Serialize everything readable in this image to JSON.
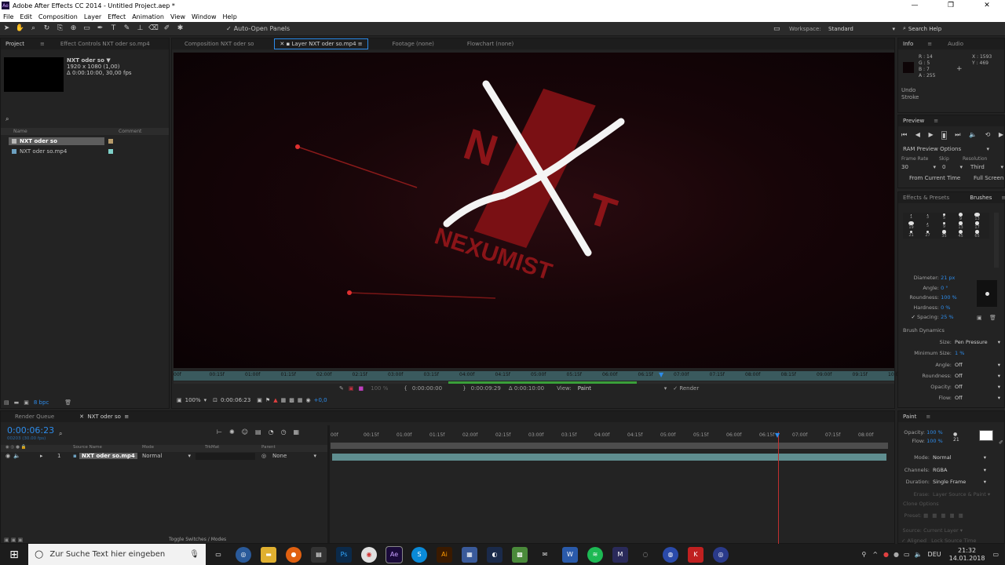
{
  "window": {
    "title": "Adobe After Effects CC 2014 - Untitled Project.aep *",
    "icon_label": "Ae"
  },
  "menu": [
    "File",
    "Edit",
    "Composition",
    "Layer",
    "Effect",
    "Animation",
    "View",
    "Window",
    "Help"
  ],
  "toolbar": {
    "auto_open": "Auto-Open Panels",
    "workspace_label": "Workspace:",
    "workspace_value": "Standard",
    "search": "Search Help"
  },
  "project": {
    "tab_project": "Project",
    "tab_effect": "Effect Controls NXT oder so.mp4",
    "item_name": "NXT oder so ▼",
    "item_res": "1920 x 1080 (1,00)",
    "item_dur": "Δ 0:00:10:00, 30,00 fps",
    "search_icon": "⌕",
    "col_name": "Name",
    "col_comment": "Comment",
    "items": [
      {
        "name": "NXT oder so",
        "color": "#b59a6a"
      },
      {
        "name": "NXT oder so.mp4",
        "color": "#7fd0c8"
      }
    ],
    "bpc": "8 bpc"
  },
  "viewer": {
    "tabs": [
      "Composition NXT oder so",
      "Layer  NXT oder so.mp4",
      "Footage (none)",
      "Flowchart (none)"
    ],
    "logo_text": "NEXUMIST",
    "ruler": [
      "00f",
      "00:15f",
      "01:00f",
      "01:15f",
      "02:00f",
      "02:15f",
      "03:00f",
      "03:15f",
      "04:00f",
      "04:15f",
      "05:00f",
      "05:15f",
      "06:00f",
      "06:15f",
      "07:00f",
      "07:15f",
      "08:00f",
      "08:15f",
      "09:00f",
      "09:15f",
      "10:0"
    ],
    "zoom_pct": "100 %",
    "t_in": "0:00:00:00",
    "t_out": "0:00:09:29",
    "t_dur": "Δ 0:00:10:00",
    "view_label": "View:",
    "view_value": "Paint",
    "render": "Render",
    "mag": "100%",
    "timecode": "0:00:06:23",
    "offset": "+0,0"
  },
  "info": {
    "tab_info": "Info",
    "tab_audio": "Audio",
    "r": "R : 14",
    "g": "G : 5",
    "b": "B : 7",
    "a": "A : 255",
    "x": "X : 1593",
    "y": "Y : 469",
    "undo": "Undo",
    "stroke": "Stroke"
  },
  "preview": {
    "tab": "Preview",
    "ram": "RAM Preview Options",
    "frame_rate_l": "Frame Rate",
    "skip_l": "Skip",
    "res_l": "Resolution",
    "frame_rate": "30",
    "skip": "0",
    "res": "Third",
    "from_current": "From Current Time",
    "full_screen": "Full Screen"
  },
  "brushes": {
    "tab_effects": "Effects & Presets",
    "tab_brushes": "Brushes",
    "sizes": [
      "1",
      "3",
      "5",
      "9",
      "13",
      "19",
      "5",
      "9",
      "13",
      "17",
      "21",
      "27",
      "35",
      "45",
      "65"
    ],
    "diameter_l": "Diameter:",
    "diameter": "21 px",
    "angle_l": "Angle:",
    "angle": "0 °",
    "roundness_l": "Roundness:",
    "roundness": "100 %",
    "hardness_l": "Hardness:",
    "hardness": "0 %",
    "spacing_l": "Spacing:",
    "spacing": "25 %",
    "dynamics": "Brush Dynamics",
    "size_l": "Size:",
    "size": "Pen Pressure",
    "minsize_l": "Minimum Size:",
    "minsize": "1 %",
    "angle2_l": "Angle:",
    "angle2": "Off",
    "roundness2_l": "Roundness:",
    "roundness2": "Off",
    "opacity_l": "Opacity:",
    "opacity": "Off",
    "flow_l": "Flow:",
    "flow": "Off"
  },
  "paint": {
    "tab": "Paint",
    "opacity_l": "Opacity:",
    "opacity": "100 %",
    "flow_l": "Flow:",
    "flow": "100 %",
    "brush_size": "21",
    "mode_l": "Mode:",
    "mode": "Normal",
    "channels_l": "Channels:",
    "channels": "RGBA",
    "duration_l": "Duration:",
    "duration": "Single Frame",
    "erase_l": "Erase:",
    "erase": "Layer Source & Paint",
    "clone": "Clone Options",
    "preset_l": "Preset:",
    "source_l": "Source:",
    "source": "Current Layer",
    "aligned": "Aligned",
    "lock": "Lock Source Time"
  },
  "timeline": {
    "tab_render": "Render Queue",
    "tab_comp": "NXT oder so",
    "timecode": "0:00:06:23",
    "frames": "00203 (30.00 fps)",
    "col_source": "Source Name",
    "col_mode": "Mode",
    "col_trkmat": "TrkMat",
    "col_parent": "Parent",
    "ruler": [
      "00f",
      "00:15f",
      "01:00f",
      "01:15f",
      "02:00f",
      "02:15f",
      "03:00f",
      "03:15f",
      "04:00f",
      "04:15f",
      "05:00f",
      "05:15f",
      "06:00f",
      "06:15f",
      "07:00f",
      "07:15f",
      "08:00f"
    ],
    "layer_num": "1",
    "layer_name": "NXT oder so.mp4",
    "layer_mode": "Normal",
    "layer_parent": "None",
    "toggle": "Toggle Switches / Modes"
  },
  "taskbar": {
    "search": "Zur Suche Text hier eingeben",
    "lang": "DEU",
    "time": "21:32",
    "date": "14.01.2018"
  }
}
